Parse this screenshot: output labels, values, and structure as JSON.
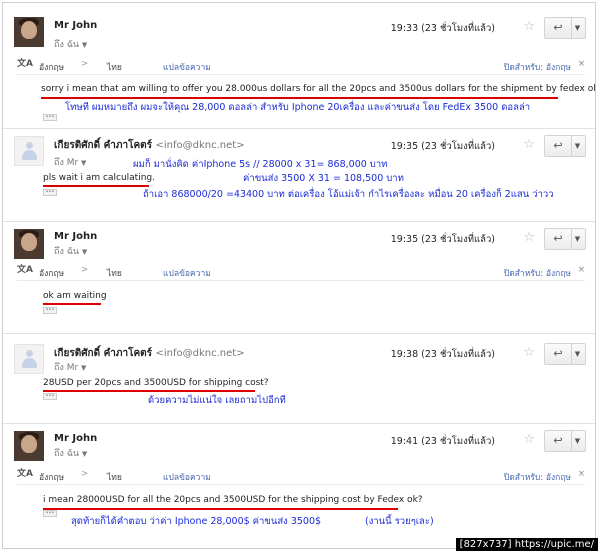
{
  "messages": [
    {
      "sender": "Mr John",
      "email": "",
      "to": "ถึง ฉัน",
      "time": "19:33 (23 ชั่วโมงที่แล้ว)",
      "translate_bar": {
        "from": "อังกฤษ",
        "arrow": ">",
        "to": "ไทย",
        "translate": "แปลข้อความ",
        "off_for": "ปิดสำหรับ: อังกฤษ",
        "close": "×"
      },
      "body": "sorry i mean that am willing to offer you 28.000us dollars for all the 20pcs and 3500us dollars for the shipment by fedex ok?",
      "notes": [
        "โทษที ผมหมายถึง ผมจะให้คุณ 28,000 ดอลล่า สำหรับ Iphone 20เครื่อง และค่าขนส่ง โดย FedEx 3500 ดอลล่า"
      ]
    },
    {
      "sender": "เกียรติศักดิ์ คำภาโคตร์",
      "email": "<info@dknc.net>",
      "to": "ถึง Mr",
      "time": "19:35 (23 ชั่วโมงที่แล้ว)",
      "body": "pls wait i am calculating.",
      "notes": [
        "ผมก็ มานั่งคิด ค่าIphone 5s // 28000 x 31= 868,000 บาท",
        "ค่าขนส่ง 3500 X 31 = 108,500 บาท",
        "ถ้าเอา 868000/20 =43400 บาท ต่อเครื่อง โอ้แม่เจ้า กำไรเครื่องละ หมื่อน 20 เครื่องก็ 2แสน ว่าวว"
      ]
    },
    {
      "sender": "Mr John",
      "email": "",
      "to": "ถึง ฉัน",
      "time": "19:35 (23 ชั่วโมงที่แล้ว)",
      "translate_bar": {
        "from": "อังกฤษ",
        "arrow": ">",
        "to": "ไทย",
        "translate": "แปลข้อความ",
        "off_for": "ปิดสำหรับ: อังกฤษ",
        "close": "×"
      },
      "body": "ok am waiting",
      "notes": []
    },
    {
      "sender": "เกียรติศักดิ์ คำภาโคตร์",
      "email": "<info@dknc.net>",
      "to": "ถึง Mr",
      "time": "19:38 (23 ชั่วโมงที่แล้ว)",
      "body": "28USD per 20pcs and 3500USD for shipping cost?",
      "notes": [
        "ด้วยความไม่แน่ใจ เลยถามไปอีกที"
      ]
    },
    {
      "sender": "Mr John",
      "email": "",
      "to": "ถึง ฉัน",
      "time": "19:41 (23 ชั่วโมงที่แล้ว)",
      "translate_bar": {
        "from": "อังกฤษ",
        "arrow": ">",
        "to": "ไทย",
        "translate": "แปลข้อความ",
        "off_for": "ปิดสำหรับ: อังกฤษ",
        "close": "×"
      },
      "body": "i mean 28000USD for all the 20pcs and 3500USD for the shipping cost by Fedex ok?",
      "notes": [
        "สุดท้ายก็ได้คำตอบ ว่าค่า Iphone 28,000$ ค่าขนส่ง 3500$",
        "(งานนี้ รวยๆเละ)"
      ]
    }
  ],
  "icons": {
    "star": "☆",
    "reply": "↩",
    "more": "▼",
    "translate": "文A",
    "ellipsis": "•••",
    "chevron": "▼"
  },
  "watermark": "[827x737] https://upic.me/",
  "colors": {
    "note": "#1b2bd6",
    "underline": "#d00000"
  }
}
